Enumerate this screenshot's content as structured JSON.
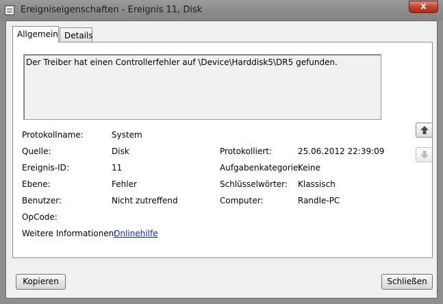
{
  "window": {
    "title": "Ereigniseigenschaften - Ereignis 11, Disk",
    "close_label": "x"
  },
  "tabs": [
    {
      "label": "Allgemein",
      "active": true
    },
    {
      "label": "Details",
      "active": false
    }
  ],
  "message": "Der Treiber hat einen Controllerfehler auf \\Device\\Harddisk5\\DR5 gefunden.",
  "fields": {
    "protokollname": {
      "label": "Protokollname:",
      "value": "System"
    },
    "quelle": {
      "label": "Quelle:",
      "value": "Disk"
    },
    "ereignis_id": {
      "label": "Ereignis-ID:",
      "value": "11"
    },
    "ebene": {
      "label": "Ebene:",
      "value": "Fehler"
    },
    "benutzer": {
      "label": "Benutzer:",
      "value": "Nicht zutreffend"
    },
    "opcode": {
      "label": "OpCode:",
      "value": ""
    },
    "weitere": {
      "label": "Weitere Informationen:",
      "link": "Onlinehilfe"
    },
    "protokolliert": {
      "label": "Protokolliert:",
      "value": "25.06.2012 22:39:09"
    },
    "aufgabenkategorie": {
      "label": "Aufgabenkategorie:",
      "value": "Keine"
    },
    "schluesselwoerter": {
      "label": "Schlüsselwörter:",
      "value": "Klassisch"
    },
    "computer": {
      "label": "Computer:",
      "value": "Randle-PC"
    }
  },
  "buttons": {
    "copy": "Kopieren",
    "close": "Schließen"
  },
  "icons": {
    "prev": "arrow-up-icon",
    "next": "arrow-down-icon"
  },
  "colors": {
    "link": "#0b28c8",
    "close_button": "#c7432b"
  }
}
